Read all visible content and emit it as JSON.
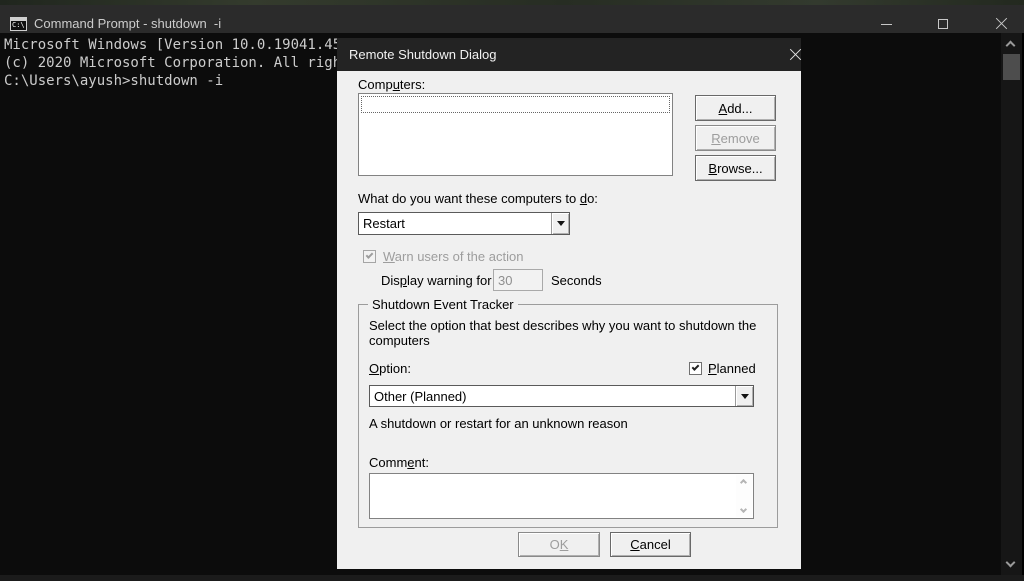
{
  "cmd_window": {
    "title": "Command Prompt - shutdown  -i",
    "icon_label": "C:\\",
    "terminal_lines": [
      "Microsoft Windows [Version 10.0.19041.45",
      "(c) 2020 Microsoft Corporation. All righ",
      "",
      "C:\\Users\\ayush>shutdown -i"
    ],
    "colors": {
      "titlebar_bg": "#2b2b2b",
      "title_text": "#cccccc",
      "terminal_bg": "#0c0c0c",
      "terminal_text": "#cccccc"
    }
  },
  "dialog": {
    "title": "Remote Shutdown Dialog",
    "colors": {
      "titlebar_bg": "#232323",
      "title_text": "#f2f2f2",
      "body_bg": "#f0f0f0",
      "disabled_text": "#9d9d9d"
    },
    "computers_label": {
      "pre": "Comp",
      "key": "u",
      "post": "ters:"
    },
    "buttons": {
      "add": {
        "pre": "",
        "key": "A",
        "post": "dd...",
        "enabled": true
      },
      "remove": {
        "pre": "",
        "key": "R",
        "post": "emove",
        "enabled": false
      },
      "browse": {
        "pre": "",
        "key": "B",
        "post": "rowse...",
        "enabled": true
      }
    },
    "action_label": {
      "pre": "What do you want these computers to ",
      "key": "d",
      "post": "o:"
    },
    "action_value": "Restart",
    "warn_checkbox": {
      "pre": "",
      "key": "W",
      "post": "arn users of the action",
      "checked": true,
      "enabled": false
    },
    "warning_label": {
      "pre": "Dis",
      "key": "p",
      "post": "lay warning for"
    },
    "warning_value": "30",
    "warning_unit": "Seconds",
    "tracker": {
      "title": "Shutdown Event Tracker",
      "description": "Select the option that best describes why you want to shutdown the computers",
      "option_label": {
        "pre": "",
        "key": "O",
        "post": "ption:"
      },
      "planned_checkbox": {
        "pre": "",
        "key": "P",
        "post": "lanned",
        "checked": true,
        "enabled": true
      },
      "option_value": "Other (Planned)",
      "option_description": "A shutdown or restart for an unknown reason",
      "comment_label": {
        "pre": "Comm",
        "key": "e",
        "post": "nt:"
      },
      "comment_value": ""
    },
    "ok_button": {
      "pre": "O",
      "key": "K",
      "post": "",
      "enabled": false
    },
    "cancel_button": {
      "pre": "",
      "key": "C",
      "post": "ancel",
      "enabled": true
    }
  }
}
